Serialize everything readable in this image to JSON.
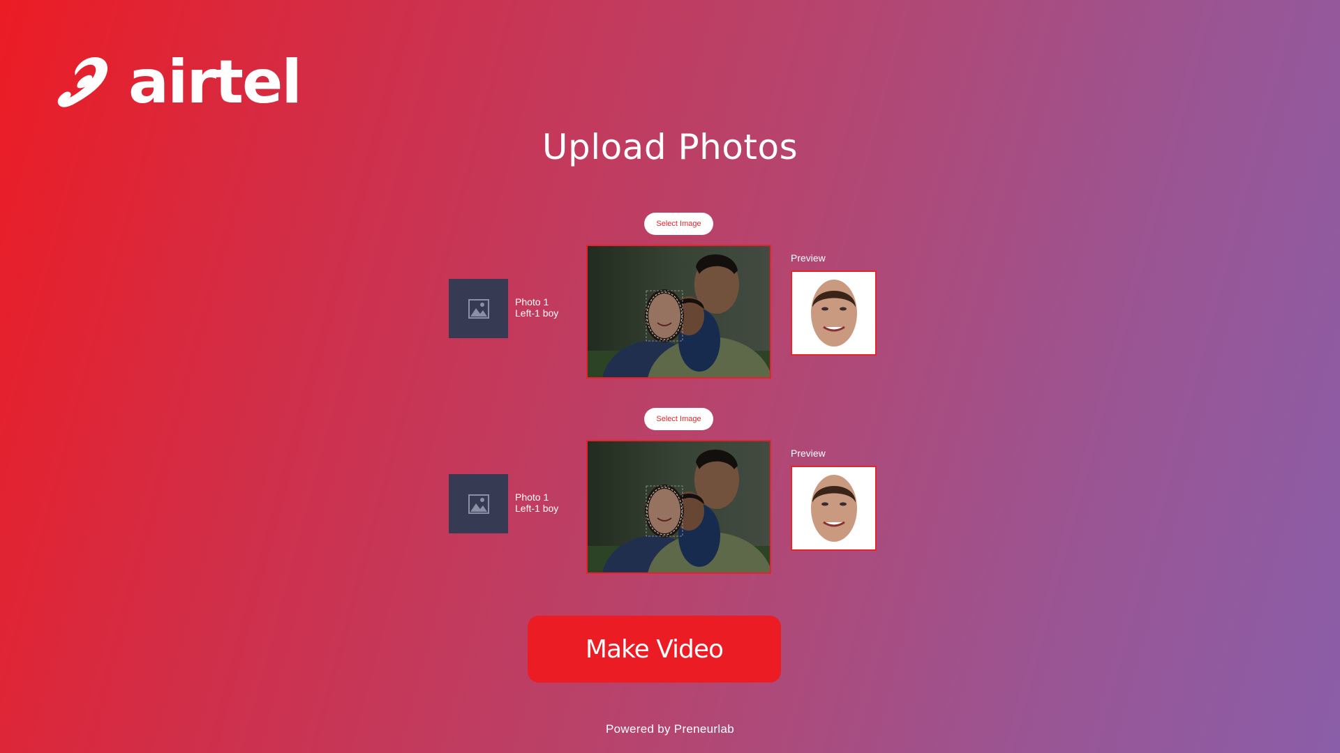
{
  "brand": {
    "name": "airtel",
    "logo_icon": "airtel-swirl-icon"
  },
  "page": {
    "title": "Upload Photos"
  },
  "photos": [
    {
      "select_label": "Select Image",
      "photo_title": "Photo 1",
      "photo_subtitle": "Left-1 boy",
      "preview_label": "Preview",
      "thumb_icon": "image-placeholder-icon"
    },
    {
      "select_label": "Select Image",
      "photo_title": "Photo 1",
      "photo_subtitle": "Left-1 boy",
      "preview_label": "Preview",
      "thumb_icon": "image-placeholder-icon"
    }
  ],
  "actions": {
    "make_video": "Make Video"
  },
  "footer": {
    "text": "Powered by Preneurlab"
  },
  "colors": {
    "brand_red": "#ec1c24",
    "gradient_end": "#8a5ea8",
    "thumb_bg": "#363b53"
  }
}
